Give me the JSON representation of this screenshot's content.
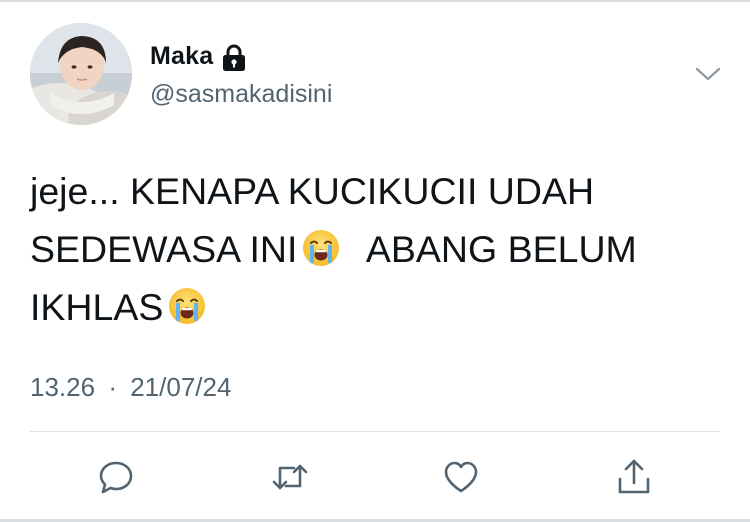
{
  "user": {
    "name": "Maka",
    "handle": "@sasmakadisini",
    "protected": true,
    "avatar_icon": "avatar-photo"
  },
  "tweet": {
    "text_part1": "jeje... KENAPA KUCIKUCII UDAH SEDEWASA INI",
    "text_part2": "ABANG BELUM IKHLAS",
    "emoji": "loudly-crying-face",
    "time": "13.26",
    "separator": "·",
    "date": "21/07/24"
  },
  "actions": {
    "reply_icon": "reply-icon",
    "retweet_icon": "retweet-icon",
    "like_icon": "heart-icon",
    "share_icon": "share-icon"
  },
  "colors": {
    "text": "#0f1419",
    "secondary": "#536471",
    "divider": "#dde2e6"
  }
}
